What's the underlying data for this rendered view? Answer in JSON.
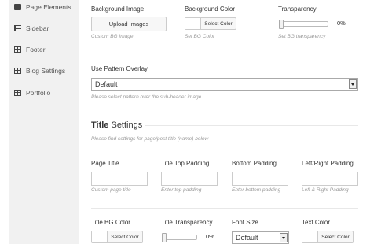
{
  "sidebar": {
    "items": [
      {
        "label": "Page Elements",
        "icon": "window-icon"
      },
      {
        "label": "Sidebar",
        "icon": "list-icon"
      },
      {
        "label": "Footer",
        "icon": "table-icon"
      },
      {
        "label": "Blog Settings",
        "icon": "table-icon"
      },
      {
        "label": "Portfolio",
        "icon": "table-icon"
      }
    ]
  },
  "background": {
    "image_label": "Background Image",
    "image_button": "Upload Images",
    "image_hint": "Custom BG Image",
    "color_label": "Background Color",
    "color_button": "Select Color",
    "color_hint": "Set BG Color",
    "transparency_label": "Transparency",
    "transparency_value": "0%",
    "transparency_level": 0,
    "transparency_hint": "Set BG transparency"
  },
  "pattern": {
    "label": "Use Pattern Overlay",
    "selected": "Default",
    "hint": "Please select pattern over the sub-header image."
  },
  "title_settings": {
    "heading_bold": "Title",
    "heading_rest": " Settings",
    "subtitle": "Please find settings for page/post title (name) below",
    "fields": [
      {
        "label": "Page Title",
        "hint": "Custom page title",
        "value": ""
      },
      {
        "label": "Title Top Padding",
        "hint": "Enter top padding",
        "value": ""
      },
      {
        "label": "Bottom Padding",
        "hint": "Enter bottom padding",
        "value": ""
      },
      {
        "label": "Left/Right Padding",
        "hint": "Left & Right Padding",
        "value": ""
      }
    ],
    "bg_color_label": "Title BG Color",
    "bg_color_button": "Select Color",
    "transparency_label": "Title Transparency",
    "transparency_value": "0%",
    "transparency_level": 0,
    "font_size_label": "Font Size",
    "font_size_selected": "Default",
    "text_color_label": "Text Color",
    "text_color_button": "Select Color"
  }
}
